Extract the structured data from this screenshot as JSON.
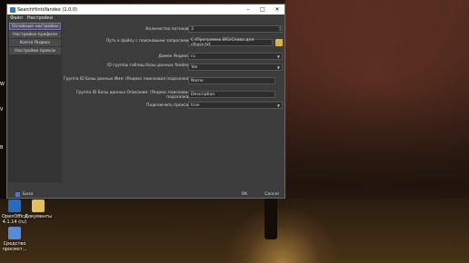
{
  "window": {
    "title": "SearchHintsYandex (1.0.0)",
    "minimize_glyph": "–",
    "maximize_glyph": "□",
    "close_glyph": "✕"
  },
  "menubar": {
    "file": "Файл",
    "settings": "Настройки"
  },
  "sidebar": {
    "items": [
      {
        "label": "Основные настройки"
      },
      {
        "label": "Настройки профиля"
      },
      {
        "label": "Капча Яндекс"
      },
      {
        "label": "Настройки прокси"
      }
    ]
  },
  "form": {
    "threads_label": "Количество потоков:",
    "threads_value": "3",
    "path_label": "Путь к файлу с поисковыми запросами:",
    "path_value": "C:/Программа BIG/Слова для сбора.txt",
    "domain_label": "Домен Яндекс:",
    "domain_value": "ru",
    "table_id_label": "ID группы таблиц базы данных Yandex:",
    "table_id_value": "Yes",
    "group_name_label": "Группа ID Базы данных Имя: (Яндекс поисковая подсказка)",
    "group_name_value": "Name",
    "group_desc_label": "Группа ID Базы данных Описание: (Яндекс поисковая подсказка)",
    "group_desc_value": "Description",
    "proxy_label": "Подключить прокси:",
    "proxy_value": "true"
  },
  "footer": {
    "base_label": "База",
    "ok_label": "OK",
    "cancel_label": "Cancel"
  },
  "desktop": {
    "icon_openoffice": "OpenOffice 4.1.14 (ru)",
    "icon_documents": "Документы",
    "icon_tools": "Средство просмот..."
  },
  "colors": {
    "window_bg": "#3c3c3c",
    "active_item_border": "#7a7ab4",
    "titlebar": "#ffffff"
  },
  "icons": [
    "app-icon",
    "folder-icon",
    "checkbox-icon",
    "openoffice-icon",
    "documents-icon",
    "viewer-icon"
  ]
}
